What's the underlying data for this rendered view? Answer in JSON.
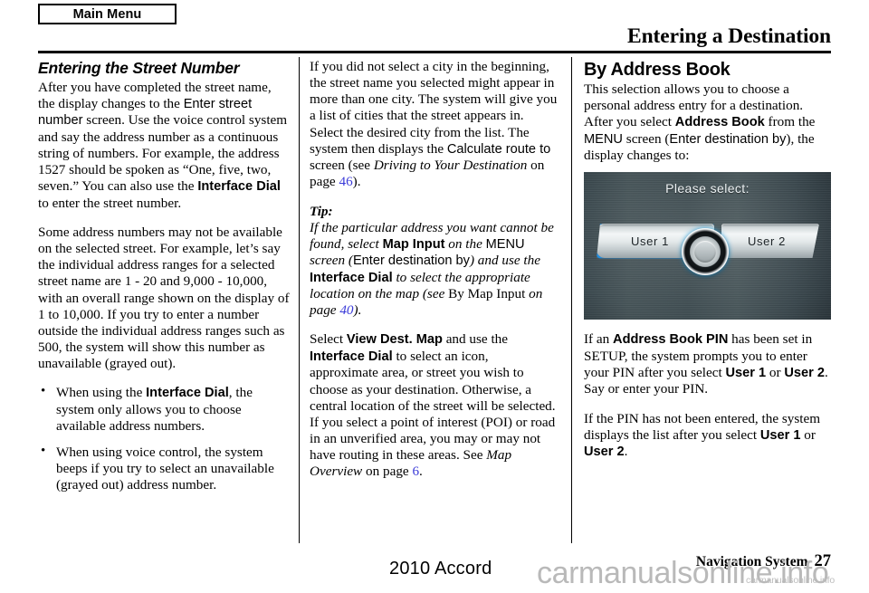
{
  "header": {
    "main_menu_label": "Main Menu",
    "title": "Entering a Destination"
  },
  "columns": {
    "col1": {
      "section_title": "Entering the Street Number",
      "para1": {
        "t1": "After you have completed the street name, the display changes to the ",
        "ui1": "Enter street number",
        "t2": " screen. Use the voice control system and say the address number as a continuous string of numbers. For example, the address 1527 should be spoken as “One, five, two, seven.” You can also use the ",
        "ui2": "Interface Dial",
        "t3": " to enter the street number."
      },
      "para2": "Some address numbers may not be available on the selected street. For example, let’s say the individual address ranges for a selected street name are 1 - 20 and 9,000 - 10,000, with an overall range shown on the display of 1 to 10,000. If you try to enter a number outside the individual address ranges such as 500, the system will show this number as unavailable (grayed out).",
      "bullet1": {
        "t1": "When using the ",
        "ui1": "Interface Dial",
        "t2": ", the system only allows you to choose available address numbers."
      },
      "bullet2": "When using voice control, the system beeps if you try to select an unavailable (grayed out) address number."
    },
    "col2": {
      "para1": {
        "t1": "If you did not select a city in the beginning, the street name you selected might appear in more than one city. The system will give you a list of cities that the street appears in. Select the desired city from the list. The system then displays the ",
        "ui1": "Calculate route to",
        "t2": " screen (see ",
        "it1": "Driving to Your Destination",
        "t3": " on page ",
        "link1": "46",
        "t4": ")."
      },
      "tip_label": "Tip:",
      "tip": {
        "t1": "If the particular address you want cannot be found, select ",
        "ui1": "Map Input",
        "t2": " on the ",
        "ui2": "MENU",
        "t3": " screen (",
        "ui3": "Enter destination by",
        "t4": ") and use the ",
        "ui4": "Interface Dial",
        "t5": " to select the appropriate location on the map (see ",
        "t6": "By Map Input",
        "t7": " on page ",
        "link1": "40",
        "t8": ")."
      },
      "para3": {
        "t1": "Select ",
        "ui1": "View Dest. Map",
        "t2": " and use the ",
        "ui2": "Interface Dial",
        "t3": " to select an icon, approximate area, or street you wish to choose as your destination. Otherwise, a central location of the street will be selected. If you select a point of interest (POI) or road in an unverified area, you may or may not have routing in these areas. See ",
        "it1": "Map Overview",
        "t4": " on page ",
        "link1": "6",
        "t5": "."
      }
    },
    "col3": {
      "section_title": "By Address Book",
      "para1": {
        "t1": "This selection allows you to choose a personal address entry for a destination. After you select ",
        "ui1": "Address Book",
        "t2": " from the ",
        "ui2": "MENU",
        "t3": " screen (",
        "ui3": "Enter destination by",
        "t4": "), the display changes to:"
      },
      "nav_screen": {
        "title": "Please select:",
        "button_user_1": "User 1",
        "button_user_2": "User 2",
        "selected": "User 1",
        "selection_color": "#1e90e8"
      },
      "para2": {
        "t1": "If an ",
        "ui1": "Address Book PIN",
        "t2": " has been set in SETUP, the system prompts you to enter your PIN after you select ",
        "ui2": "User 1",
        "t3": " or ",
        "ui3": "User 2",
        "t4": ". Say or enter your PIN."
      },
      "para3": {
        "t1": "If the PIN has not been entered, the system displays the list after you select ",
        "ui1": "User 1",
        "t2": " or ",
        "ui2": "User 2",
        "t3": "."
      }
    }
  },
  "footer": {
    "model": "2010 Accord",
    "section": "Navigation System",
    "page_number": "27",
    "watermark": "carmanualsonline.info",
    "watermark_small": "carmanualsonline.info"
  }
}
